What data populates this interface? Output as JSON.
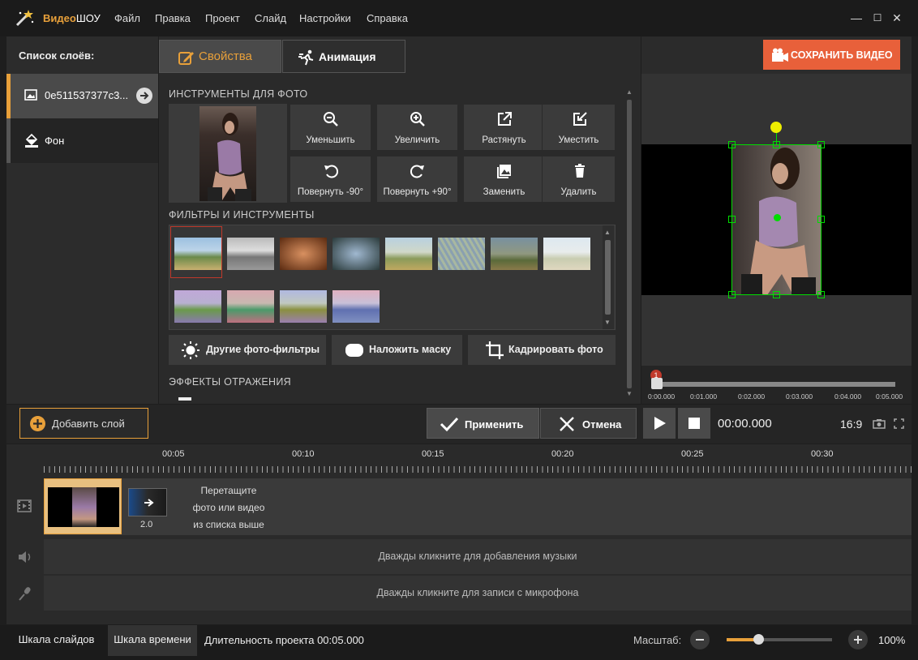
{
  "app": {
    "title_brand": "Видео",
    "title_rest": "ШОУ"
  },
  "menu": [
    "Файл",
    "Правка",
    "Проект",
    "Слайд",
    "Настройки",
    "Справка"
  ],
  "window_controls": {
    "minimize": "—",
    "maximize": "☐",
    "close": "✕"
  },
  "layers": {
    "title": "Список слоёв:",
    "items": [
      {
        "label": "0e511537377c3...",
        "icon": "image-icon"
      },
      {
        "label": "Фон",
        "icon": "paint-bucket-icon"
      }
    ]
  },
  "tabs": [
    {
      "label": "Свойства",
      "icon": "edit-icon"
    },
    {
      "label": "Анимация",
      "icon": "running-man-icon"
    }
  ],
  "photo_tools": {
    "heading": "ИНСТРУМЕНТЫ ДЛЯ ФОТО",
    "buttons": [
      {
        "label": "Уменьшить",
        "icon": "zoom-out-icon"
      },
      {
        "label": "Увеличить",
        "icon": "zoom-in-icon"
      },
      {
        "label": "Растянуть",
        "icon": "stretch-icon"
      },
      {
        "label": "Уместить",
        "icon": "fit-icon"
      },
      {
        "label": "Повернуть -90°",
        "icon": "rotate-left-icon"
      },
      {
        "label": "Повернуть +90°",
        "icon": "rotate-right-icon"
      },
      {
        "label": "Заменить",
        "icon": "replace-image-icon"
      },
      {
        "label": "Удалить",
        "icon": "trash-icon"
      }
    ]
  },
  "filters": {
    "heading": "ФИЛЬТРЫ И ИНСТРУМЕНТЫ",
    "buttons": [
      {
        "label": "Другие фото-фильтры",
        "icon": "sun-icon"
      },
      {
        "label": "Наложить маску",
        "icon": "mask-icon"
      },
      {
        "label": "Кадрировать фото",
        "icon": "crop-icon"
      }
    ]
  },
  "reflection": {
    "heading": "ЭФФЕКТЫ ОТРАЖЕНИЯ"
  },
  "save_button": "СОХРАНИТЬ ВИДЕО",
  "preview_timeline": {
    "marker": "1",
    "ticks": [
      "0:00.000",
      "0:01.000",
      "0:02.000",
      "0:03.000",
      "0:04.000",
      "0:05.000"
    ]
  },
  "toolbar": {
    "add_layer": "Добавить слой",
    "apply": "Применить",
    "cancel": "Отмена",
    "time": "00:00.000",
    "aspect": "16:9"
  },
  "timeline": {
    "ruler": [
      "00:05",
      "00:10",
      "00:15",
      "00:20",
      "00:25",
      "00:30"
    ],
    "transition_duration": "2.0",
    "drop_hint": [
      "Перетащите",
      "фото или видео",
      "из списка выше"
    ],
    "music_hint": "Дважды кликните для добавления музыки",
    "mic_hint": "Дважды кликните для записи с микрофона"
  },
  "status": {
    "tab_slides": "Шкала слайдов",
    "tab_time": "Шкала времени",
    "duration": "Длительность проекта 00:05.000",
    "zoom_label": "Масштаб:",
    "zoom_value": "100%",
    "zoom_fraction": 0.3
  },
  "colors": {
    "accent": "#e8a03a",
    "save": "#e8603a",
    "selection": "#00dd00",
    "handle": "#eeee00"
  }
}
